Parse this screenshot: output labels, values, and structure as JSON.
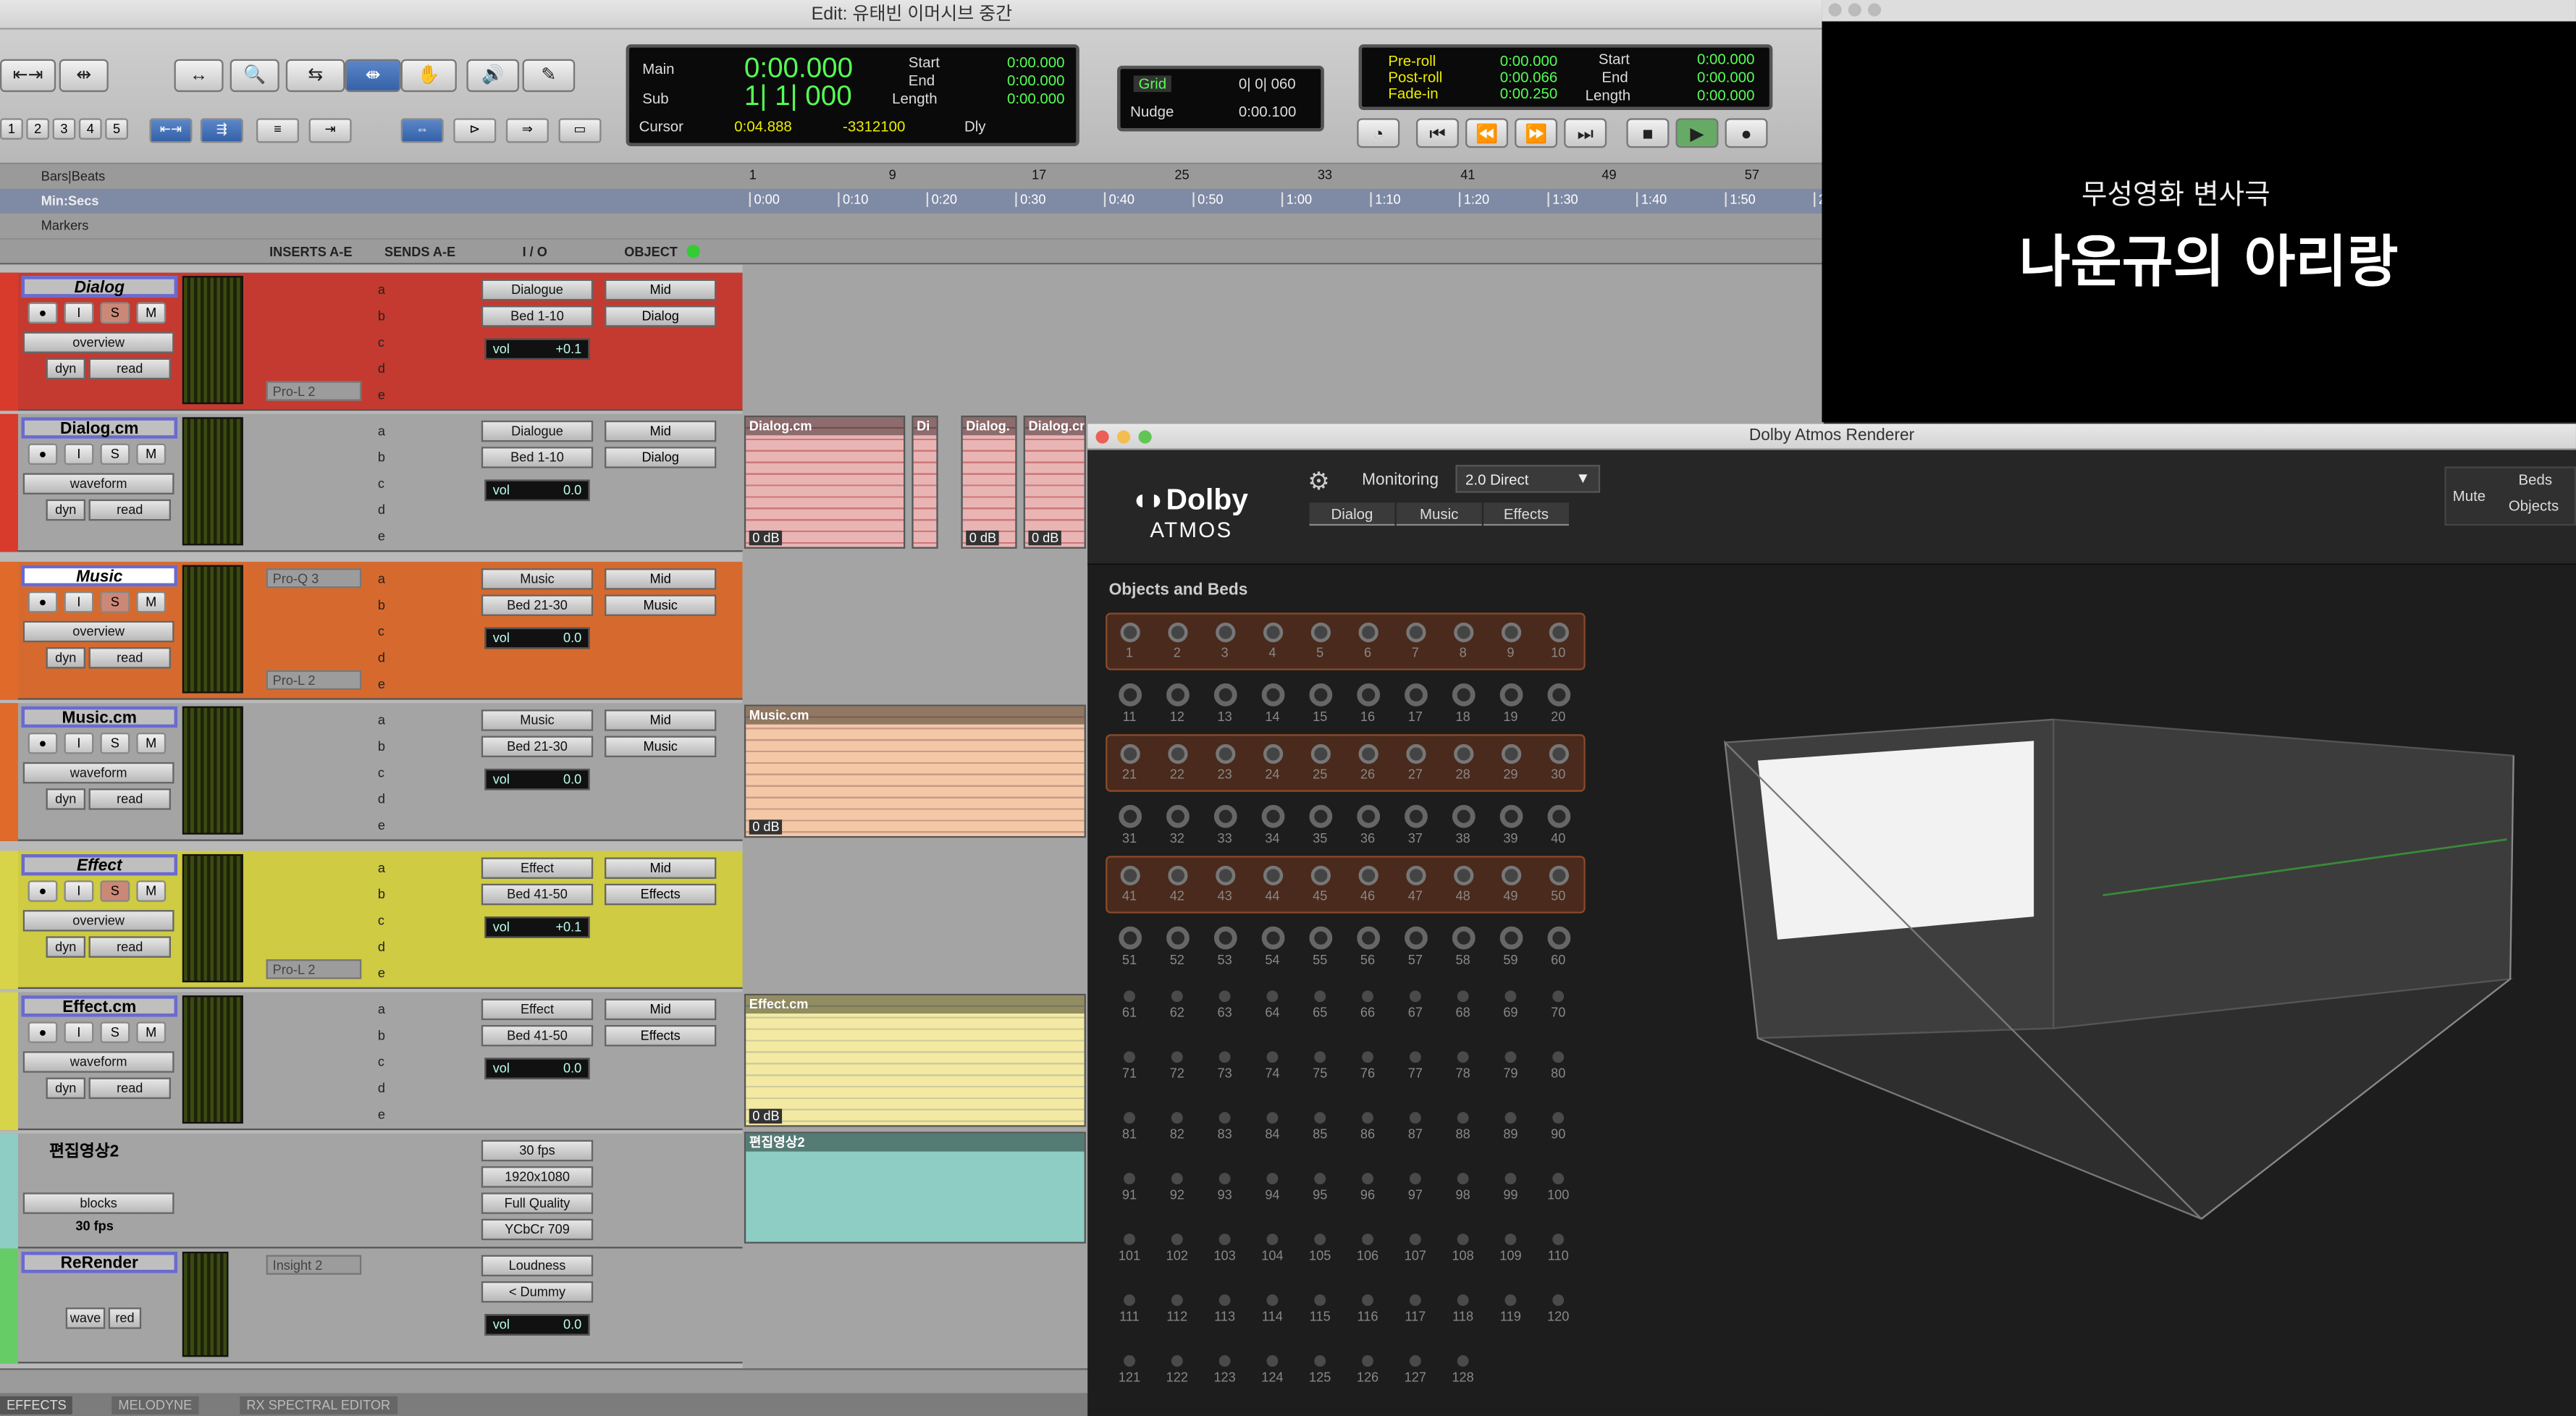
{
  "window_title": "Edit: 유태빈 이머시브 중간",
  "toolbar": {
    "nums": [
      "1",
      "2",
      "3",
      "4",
      "5"
    ],
    "counter": {
      "main_label": "Main",
      "main_value": "0:00.000",
      "sub_label": "Sub",
      "sub_value": "1| 1| 000",
      "start_label": "Start",
      "start_value": "0:00.000",
      "end_label": "End",
      "end_value": "0:00.000",
      "length_label": "Length",
      "length_value": "0:00.000",
      "cursor_label": "Cursor",
      "cursor_value": "0:04.888",
      "cursor_sample": "-3312100",
      "dly": "Dly"
    },
    "grid_label": "Grid",
    "grid_value": "0| 0| 060",
    "nudge_label": "Nudge",
    "nudge_value": "0:00.100",
    "transport": {
      "preroll_label": "Pre-roll",
      "preroll_value": "0:00.000",
      "postroll_label": "Post-roll",
      "postroll_value": "0:00.066",
      "fadein_label": "Fade-in",
      "fadein_value": "0:00.250",
      "start_label": "Start",
      "start_value": "0:00.000",
      "end_label": "End",
      "end_value": "0:00.000",
      "length_label": "Length",
      "length_value": "0:00.000"
    }
  },
  "rulers": {
    "bars_label": "Bars|Beats",
    "minsec_label": "Min:Secs",
    "markers_label": "Markers",
    "bars": [
      "1",
      "9",
      "17",
      "25",
      "33",
      "41",
      "49",
      "57"
    ],
    "secs": [
      "0:00",
      "0:10",
      "0:20",
      "0:30",
      "0:40",
      "0:50",
      "1:00",
      "1:10",
      "1:20",
      "1:30",
      "1:40",
      "1:50",
      "2"
    ]
  },
  "columns": {
    "inserts": "INSERTS A-E",
    "sends": "SENDS A-E",
    "io": "I / O",
    "object": "OBJECT"
  },
  "tracks": [
    {
      "name": "Dialog",
      "view": "overview",
      "dyn": "dyn",
      "read": "read",
      "insert": "Pro-L 2",
      "in": "Dialogue",
      "out": "Bed 1-10",
      "vol": "vol",
      "vol_value": "+0.1",
      "obj": "Mid",
      "obj_bus": "Dialog"
    },
    {
      "name": "Dialog.cm",
      "view": "waveform",
      "dyn": "dyn",
      "read": "read",
      "in": "Dialogue",
      "out": "Bed 1-10",
      "vol": "vol",
      "vol_value": "0.0",
      "obj": "Mid",
      "obj_bus": "Dialog"
    },
    {
      "name": "Music",
      "view": "overview",
      "dyn": "dyn",
      "read": "read",
      "insert_top": "Pro-Q 3",
      "insert": "Pro-L 2",
      "in": "Music",
      "out": "Bed 21-30",
      "vol": "vol",
      "vol_value": "0.0",
      "obj": "Mid",
      "obj_bus": "Music"
    },
    {
      "name": "Music.cm",
      "view": "waveform",
      "dyn": "dyn",
      "read": "read",
      "in": "Music",
      "out": "Bed 21-30",
      "vol": "vol",
      "vol_value": "0.0",
      "obj": "Mid",
      "obj_bus": "Music"
    },
    {
      "name": "Effect",
      "view": "overview",
      "dyn": "dyn",
      "read": "read",
      "insert": "Pro-L 2",
      "in": "Effect",
      "out": "Bed 41-50",
      "vol": "vol",
      "vol_value": "+0.1",
      "obj": "Mid",
      "obj_bus": "Effects"
    },
    {
      "name": "Effect.cm",
      "view": "waveform",
      "dyn": "dyn",
      "read": "read",
      "in": "Effect",
      "out": "Bed 41-50",
      "vol": "vol",
      "vol_value": "0.0",
      "obj": "Mid",
      "obj_bus": "Effects"
    }
  ],
  "video_track": {
    "name": "편집영상2",
    "view": "blocks",
    "fps_label": "30 fps",
    "fps": "30 fps",
    "res": "1920x1080",
    "quality": "Full Quality",
    "color": "YCbCr 709",
    "clip": "편집영상2"
  },
  "rerender_track": {
    "name": "ReRender",
    "view": "wave",
    "read": "red",
    "insert": "Insight 2",
    "in": "Loudness",
    "out": "< Dummy",
    "vol": "vol",
    "vol_value": "0.0"
  },
  "send_letters": [
    "a",
    "b",
    "c",
    "d",
    "e"
  ],
  "clips": {
    "dialog1": "Dialog.cm",
    "dialog2": "Di",
    "dialog3": "Dialog.",
    "dialog4": "Dialog.cm",
    "gain": "0 dB",
    "music": "Music.cm",
    "effect": "Effect.cm"
  },
  "bottom_tabs": [
    "EFFECTS",
    "MELODYNE",
    "RX SPECTRAL EDITOR"
  ],
  "video_text": {
    "line1": "무성영화 변사극",
    "line2": "나운규의 아리랑"
  },
  "dolby": {
    "title": "Dolby Atmos Renderer",
    "logo_top": "Dolby",
    "logo_bottom": "ATMOS",
    "monitoring_label": "Monitoring",
    "monitoring_value": "2.0 Direct",
    "tabs": [
      "Dialog",
      "Music",
      "Effects"
    ],
    "mute": "Mute",
    "beds": "Beds",
    "objects": "Objects",
    "section": "Objects and Beds",
    "count": 128,
    "highlight_rows": [
      0,
      2,
      4
    ]
  },
  "colors": {
    "dialog": "#d83a2c",
    "music": "#e06a2a",
    "effect": "#d8d44a",
    "video": "#8ecdc3",
    "selection": "#3461a8"
  }
}
